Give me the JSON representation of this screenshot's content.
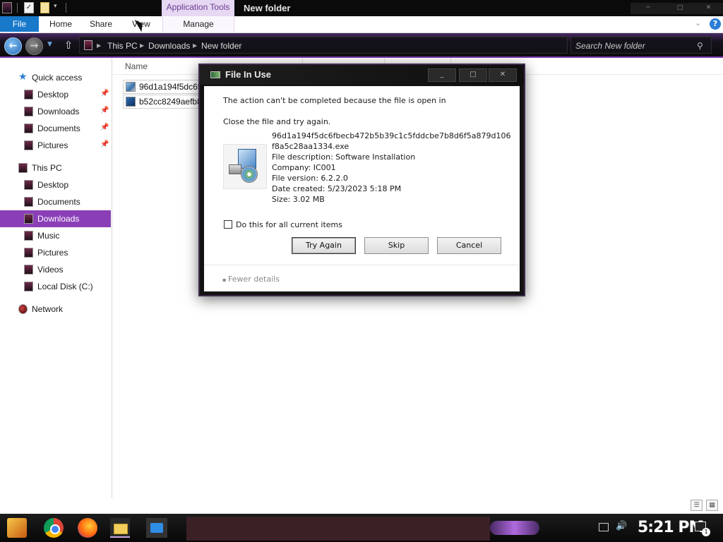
{
  "titlebar": {
    "contextual_tab": "Application Tools",
    "window_title": "New folder",
    "properties_glyph": "✓"
  },
  "ribbon": {
    "tabs": [
      {
        "label": "File"
      },
      {
        "label": "Home"
      },
      {
        "label": "Share"
      },
      {
        "label": "View"
      },
      {
        "label": "Manage"
      }
    ]
  },
  "address": {
    "breadcrumbs": [
      "This PC",
      "Downloads",
      "New folder"
    ],
    "search_placeholder": "Search New folder"
  },
  "nav_pane": {
    "quick_access": "Quick access",
    "quick_items": [
      "Desktop",
      "Downloads",
      "Documents",
      "Pictures"
    ],
    "this_pc": "This PC",
    "pc_items": [
      "Desktop",
      "Documents",
      "Downloads",
      "Music",
      "Pictures",
      "Videos",
      "Local Disk (C:)"
    ],
    "network": "Network",
    "selected": "Downloads"
  },
  "file_list": {
    "column_name": "Name",
    "files": [
      "96d1a194f5dc6fb",
      "b52cc8249aefb8c"
    ]
  },
  "dialog": {
    "title": "File In Use",
    "message": "The action can't be completed because the file is open in",
    "instruction": "Close the file and try again.",
    "file_name_line1": "96d1a194f5dc6fbecb472b5b39c1c5fddcbe7b8d6f5a879d106",
    "file_name_line2": "f8a5c28aa1334.exe",
    "file_description": "File description: Software Installation",
    "company": "Company: IC001",
    "file_version": "File version: 6.2.2.0",
    "date_created": "Date created: 5/23/2023 5:18 PM",
    "size": "Size: 3.02 MB",
    "checkbox_label": "Do this for all current items",
    "checkbox_checked": false,
    "buttons": {
      "try_again": "Try Again",
      "skip": "Skip",
      "cancel": "Cancel"
    },
    "fewer_details": "Fewer details"
  },
  "taskbar": {
    "clock": "5:21 PM",
    "notification_count": "1"
  },
  "icons": {
    "start": "start-icon",
    "chrome": "chrome-icon",
    "firefox": "firefox-icon",
    "explorer": "file-explorer-icon",
    "mail": "mail-icon"
  },
  "colors": {
    "accent": "#8a3fb7",
    "file_tab": "#1979ca",
    "contextual_tab": "#e6d7f2"
  }
}
